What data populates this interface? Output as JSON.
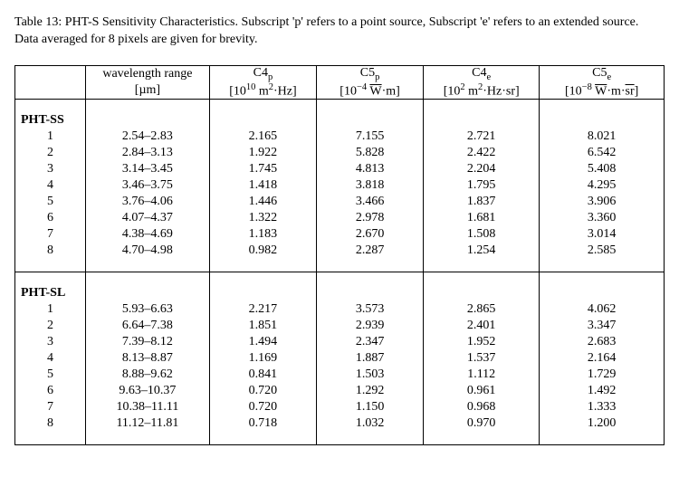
{
  "caption": "Table 13: PHT-S Sensitivity Characteristics. Subscript 'p' refers to a point source, Subscript 'e' refers to an extended source. Data averaged for 8 pixels are given for brevity.",
  "columns": {
    "c0": "",
    "c1_top": "wavelength range",
    "c1_bot_html": "[µm]",
    "c2_top_html": "C4<sub>p</sub>",
    "c2_bot_html": "[10<sup>10</sup> m<sup>2</sup>·Hz]",
    "c3_top_html": "C5<sub>p</sub>",
    "c3_bot_html": "[10<sup>−4</sup> <span class='sqrt'>W</span>·m]",
    "c4_top_html": "C4<sub>e</sub>",
    "c4_bot_html": "[10<sup>2</sup> m<sup>2</sup>·Hz·sr]",
    "c5_top_html": "C5<sub>e</sub>",
    "c5_bot_html": "[10<sup>−8</sup> <span class='sqrt'>W</span>·m·<span class='sqrt'>sr</span>]"
  },
  "sections": [
    {
      "label": "PHT-SS",
      "rows": [
        {
          "idx": "1",
          "wl": "2.54–2.83",
          "c4p": "2.165",
          "c5p": "7.155",
          "c4e": "2.721",
          "c5e": "8.021"
        },
        {
          "idx": "2",
          "wl": "2.84–3.13",
          "c4p": "1.922",
          "c5p": "5.828",
          "c4e": "2.422",
          "c5e": "6.542"
        },
        {
          "idx": "3",
          "wl": "3.14–3.45",
          "c4p": "1.745",
          "c5p": "4.813",
          "c4e": "2.204",
          "c5e": "5.408"
        },
        {
          "idx": "4",
          "wl": "3.46–3.75",
          "c4p": "1.418",
          "c5p": "3.818",
          "c4e": "1.795",
          "c5e": "4.295"
        },
        {
          "idx": "5",
          "wl": "3.76–4.06",
          "c4p": "1.446",
          "c5p": "3.466",
          "c4e": "1.837",
          "c5e": "3.906"
        },
        {
          "idx": "6",
          "wl": "4.07–4.37",
          "c4p": "1.322",
          "c5p": "2.978",
          "c4e": "1.681",
          "c5e": "3.360"
        },
        {
          "idx": "7",
          "wl": "4.38–4.69",
          "c4p": "1.183",
          "c5p": "2.670",
          "c4e": "1.508",
          "c5e": "3.014"
        },
        {
          "idx": "8",
          "wl": "4.70–4.98",
          "c4p": "0.982",
          "c5p": "2.287",
          "c4e": "1.254",
          "c5e": "2.585"
        }
      ]
    },
    {
      "label": "PHT-SL",
      "rows": [
        {
          "idx": "1",
          "wl": "5.93–6.63",
          "c4p": "2.217",
          "c5p": "3.573",
          "c4e": "2.865",
          "c5e": "4.062"
        },
        {
          "idx": "2",
          "wl": "6.64–7.38",
          "c4p": "1.851",
          "c5p": "2.939",
          "c4e": "2.401",
          "c5e": "3.347"
        },
        {
          "idx": "3",
          "wl": "7.39–8.12",
          "c4p": "1.494",
          "c5p": "2.347",
          "c4e": "1.952",
          "c5e": "2.683"
        },
        {
          "idx": "4",
          "wl": "8.13–8.87",
          "c4p": "1.169",
          "c5p": "1.887",
          "c4e": "1.537",
          "c5e": "2.164"
        },
        {
          "idx": "5",
          "wl": "8.88–9.62",
          "c4p": "0.841",
          "c5p": "1.503",
          "c4e": "1.112",
          "c5e": "1.729"
        },
        {
          "idx": "6",
          "wl": "9.63–10.37",
          "c4p": "0.720",
          "c5p": "1.292",
          "c4e": "0.961",
          "c5e": "1.492"
        },
        {
          "idx": "7",
          "wl": "10.38–11.11",
          "c4p": "0.720",
          "c5p": "1.150",
          "c4e": "0.968",
          "c5e": "1.333"
        },
        {
          "idx": "8",
          "wl": "11.12–11.81",
          "c4p": "0.718",
          "c5p": "1.032",
          "c4e": "0.970",
          "c5e": "1.200"
        }
      ]
    }
  ],
  "chart_data": {
    "type": "table",
    "title": "PHT-S Sensitivity Characteristics",
    "columns": [
      "pixel",
      "wavelength_range_um",
      "C4p_1e10_m2Hz",
      "C5p_1e-4_sqrtW_m",
      "C4e_1e2_m2Hz_sr",
      "C5e_1e-8_sqrtW_m_sqrtsr"
    ],
    "series": [
      {
        "name": "PHT-SS",
        "values": [
          [
            1,
            "2.54–2.83",
            2.165,
            7.155,
            2.721,
            8.021
          ],
          [
            2,
            "2.84–3.13",
            1.922,
            5.828,
            2.422,
            6.542
          ],
          [
            3,
            "3.14–3.45",
            1.745,
            4.813,
            2.204,
            5.408
          ],
          [
            4,
            "3.46–3.75",
            1.418,
            3.818,
            1.795,
            4.295
          ],
          [
            5,
            "3.76–4.06",
            1.446,
            3.466,
            1.837,
            3.906
          ],
          [
            6,
            "4.07–4.37",
            1.322,
            2.978,
            1.681,
            3.36
          ],
          [
            7,
            "4.38–4.69",
            1.183,
            2.67,
            1.508,
            3.014
          ],
          [
            8,
            "4.70–4.98",
            0.982,
            2.287,
            1.254,
            2.585
          ]
        ]
      },
      {
        "name": "PHT-SL",
        "values": [
          [
            1,
            "5.93–6.63",
            2.217,
            3.573,
            2.865,
            4.062
          ],
          [
            2,
            "6.64–7.38",
            1.851,
            2.939,
            2.401,
            3.347
          ],
          [
            3,
            "7.39–8.12",
            1.494,
            2.347,
            1.952,
            2.683
          ],
          [
            4,
            "8.13–8.87",
            1.169,
            1.887,
            1.537,
            2.164
          ],
          [
            5,
            "8.88–9.62",
            0.841,
            1.503,
            1.112,
            1.729
          ],
          [
            6,
            "9.63–10.37",
            0.72,
            1.292,
            0.961,
            1.492
          ],
          [
            7,
            "10.38–11.11",
            0.72,
            1.15,
            0.968,
            1.333
          ],
          [
            8,
            "11.12–11.81",
            0.718,
            1.032,
            0.97,
            1.2
          ]
        ]
      }
    ]
  }
}
